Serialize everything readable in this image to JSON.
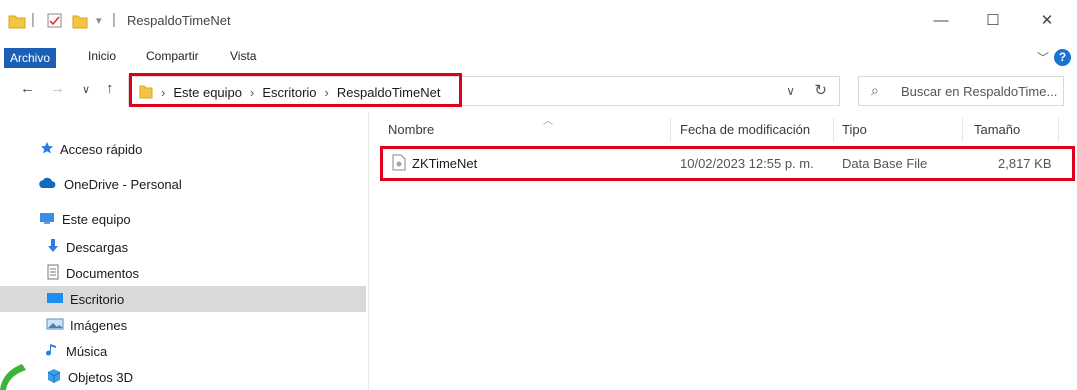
{
  "window": {
    "title": "RespaldoTimeNet",
    "controls": {
      "minimize": "—",
      "maximize": "☐",
      "close": "✕"
    }
  },
  "ribbon": {
    "tabs": [
      "Archivo",
      "Inicio",
      "Compartir",
      "Vista"
    ],
    "active_tab": "Archivo",
    "help": "?"
  },
  "address": {
    "crumbs": [
      "Este equipo",
      "Escritorio",
      "RespaldoTimeNet"
    ],
    "search_placeholder": "Buscar en RespaldoTime..."
  },
  "nav": {
    "items": [
      {
        "label": "Acceso rápido",
        "icon": "star-icon",
        "selected": false
      },
      {
        "label": "OneDrive - Personal",
        "icon": "cloud-icon",
        "selected": false
      },
      {
        "label": "Este equipo",
        "icon": "computer-icon",
        "selected": false
      },
      {
        "label": "Descargas",
        "icon": "download-icon",
        "selected": false
      },
      {
        "label": "Documentos",
        "icon": "document-icon",
        "selected": false
      },
      {
        "label": "Escritorio",
        "icon": "desktop-icon",
        "selected": true
      },
      {
        "label": "Imágenes",
        "icon": "pictures-icon",
        "selected": false
      },
      {
        "label": "Música",
        "icon": "music-icon",
        "selected": false
      },
      {
        "label": "Objetos 3D",
        "icon": "cube-icon",
        "selected": false
      }
    ]
  },
  "table": {
    "columns": [
      "Nombre",
      "Fecha de modificación",
      "Tipo",
      "Tamaño"
    ],
    "rows": [
      {
        "name": "ZKTimeNet",
        "modified": "10/02/2023 12:55 p. m.",
        "type": "Data Base File",
        "size": "2,817 KB"
      }
    ]
  },
  "colors": {
    "accent": "#1a5fb4",
    "highlight": "#e0001b",
    "selection": "#d9d9d9"
  }
}
